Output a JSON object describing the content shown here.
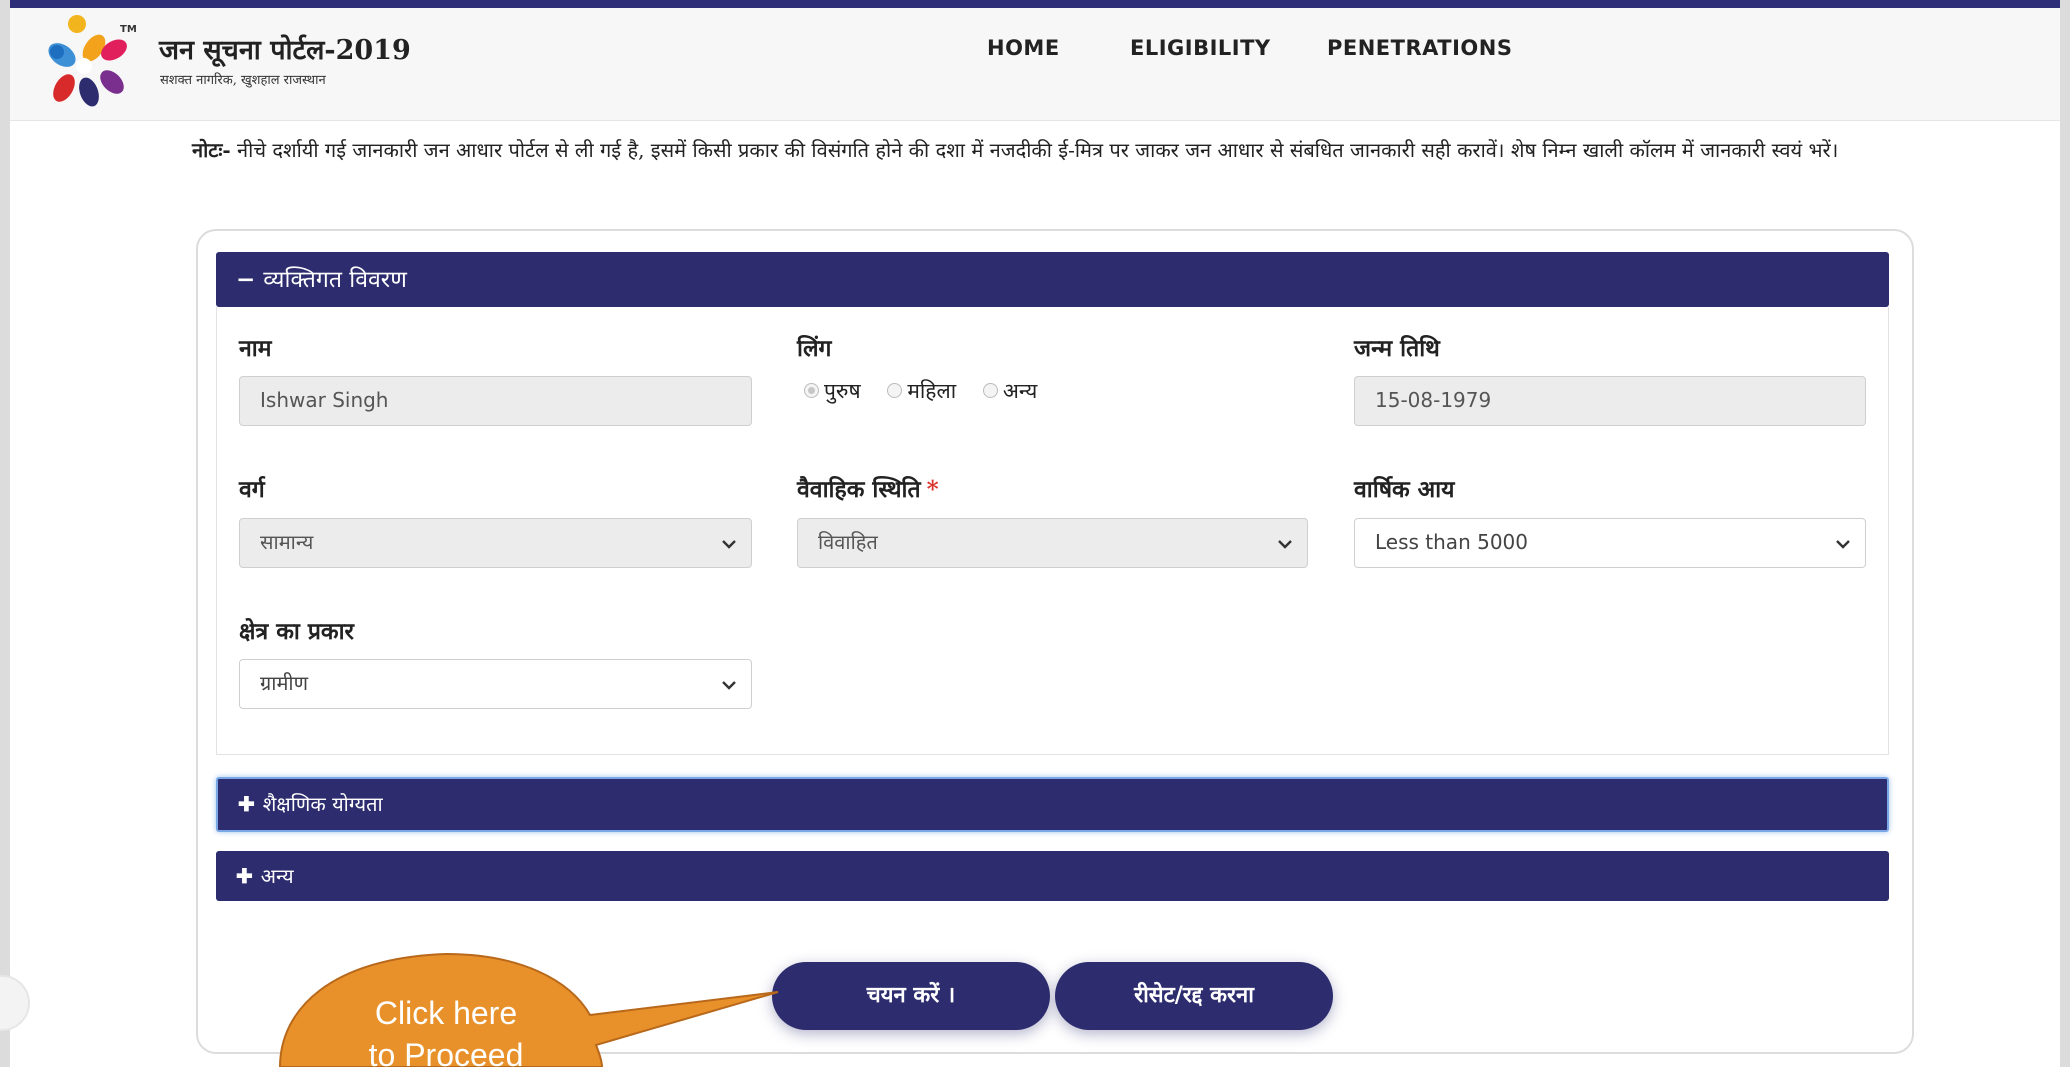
{
  "header": {
    "brand_title": "जन सूचना पोर्टल-2019",
    "brand_subtitle": "सशक्त नागरिक, खुशहाल राजस्थान",
    "trademark": "TM",
    "nav": [
      "HOME",
      "ELIGIBILITY",
      "PENETRATIONS"
    ]
  },
  "note": {
    "prefix": "नोटः-",
    "text": " नीचे दर्शायी गई जानकारी जन आधार पोर्टल से ली गई है, इसमें किसी प्रकार की विसंगति होने की दशा में नजदीकी ई-मित्र पर जाकर जन आधार से संबधित जानकारी सही करावें। शेष निम्न खाली कॉलम में जानकारी स्वयं भरें।"
  },
  "sections": {
    "personal": {
      "sign": "−",
      "title": "व्यक्तिगत विवरण"
    },
    "education": {
      "sign": "✚",
      "title": "शैक्षणिक योग्यता"
    },
    "other": {
      "sign": "✚",
      "title": "अन्य"
    }
  },
  "fields": {
    "name": {
      "label": "नाम",
      "value": "Ishwar Singh"
    },
    "gender": {
      "label": "लिंग",
      "options": [
        "पुरुष",
        "महिला",
        "अन्य"
      ],
      "selected": "पुरुष"
    },
    "dob": {
      "label": "जन्म तिथि",
      "value": "15-08-1979"
    },
    "category": {
      "label": "वर्ग",
      "value": "सामान्य"
    },
    "marital": {
      "label": "वैवाहिक स्थिति",
      "required_mark": "*",
      "value": "विवाहित"
    },
    "income": {
      "label": "वार्षिक आय",
      "value": "Less than 5000"
    },
    "area": {
      "label": "क्षेत्र का प्रकार",
      "value": "ग्रामीण"
    }
  },
  "buttons": {
    "select": "चयन करें ।",
    "reset": "रीसेट/रद्द करना"
  },
  "callout": {
    "line1": "Click here",
    "line2": "to Proceed",
    "color": "#e8912a"
  },
  "colors": {
    "primary": "#2c2c6e",
    "required": "#d9342b"
  }
}
